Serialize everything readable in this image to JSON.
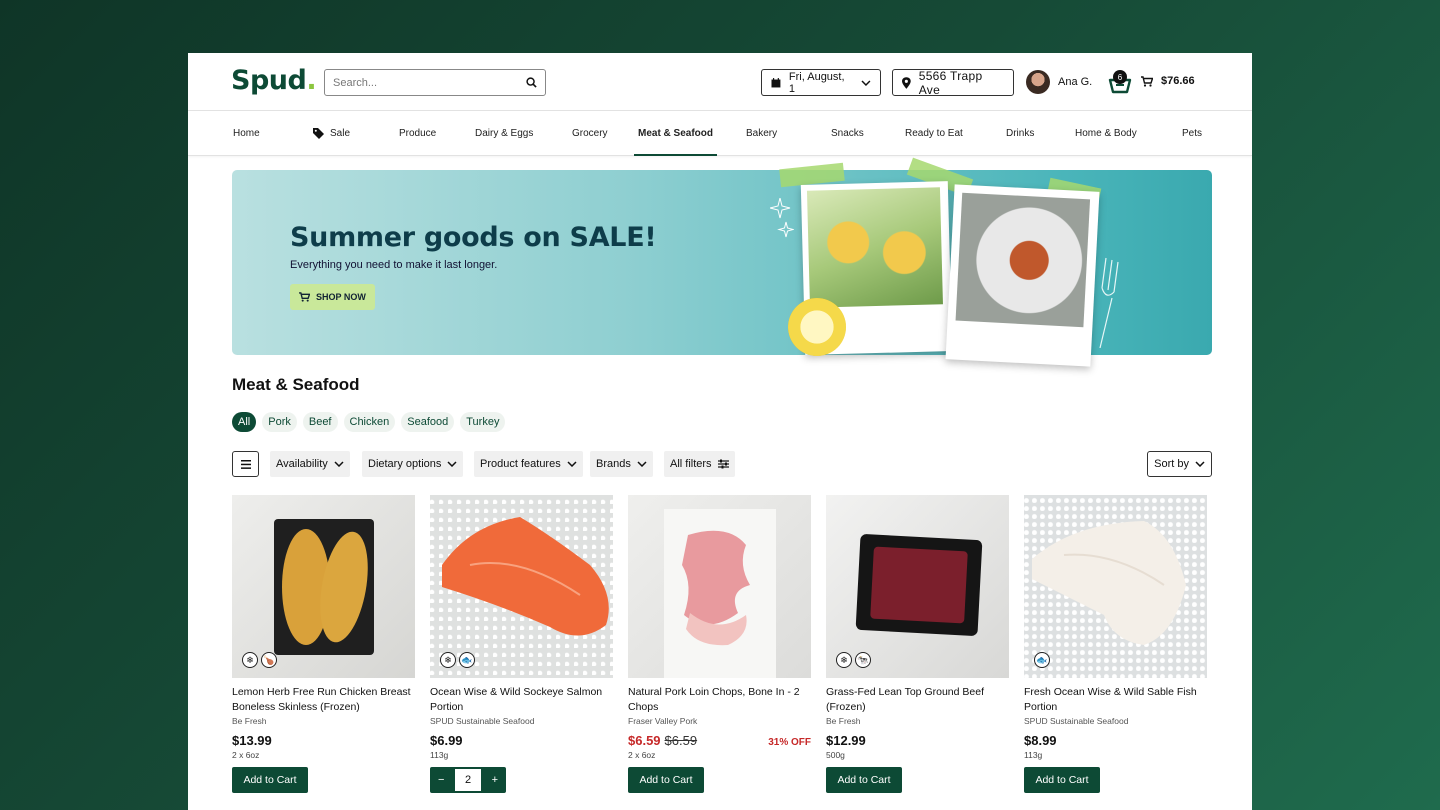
{
  "header": {
    "logo": "Spud",
    "logo_dot": ".",
    "search_placeholder": "Search...",
    "date": "Fri, August, 1",
    "address": "5566 Trapp Ave",
    "user_name": "Ana G.",
    "basket_count": "6",
    "cart_total": "$76.66"
  },
  "nav": {
    "items": [
      "Home",
      "Sale",
      "Produce",
      "Dairy & Eggs",
      "Grocery",
      "Meat & Seafood",
      "Bakery",
      "Snacks",
      "Ready to Eat",
      "Drinks",
      "Home & Body",
      "Pets"
    ],
    "active": "Meat & Seafood"
  },
  "banner": {
    "title": "Summer goods on SALE!",
    "subtitle": "Everything you need to make it last longer.",
    "button": "SHOP NOW"
  },
  "section": {
    "title": "Meat & Seafood",
    "chips": [
      "All",
      "Pork",
      "Beef",
      "Chicken",
      "Seafood",
      "Turkey"
    ],
    "active_chip": "All"
  },
  "filters": {
    "items": [
      "Availability",
      "Dietary options",
      "Product features",
      "Brands"
    ],
    "all_filters": "All filters",
    "sort": "Sort by"
  },
  "products": [
    {
      "name": "Lemon Herb Free Run Chicken Breast Boneless Skinless (Frozen)",
      "brand": "Be Fresh",
      "price": "$13.99",
      "size": "2 x 6oz",
      "button": "Add to Cart",
      "badges": [
        "snowflake-icon",
        "drumstick-icon"
      ]
    },
    {
      "name": "Ocean Wise & Wild Sockeye Salmon Portion",
      "brand": "SPUD Sustainable Seafood",
      "price": "$6.99",
      "size": "113g",
      "quantity": "2",
      "badges": [
        "snowflake-icon",
        "fish-icon"
      ]
    },
    {
      "name": "Natural Pork Loin Chops, Bone In - 2 Chops",
      "brand": "Fraser Valley Pork",
      "sale_price": "$6.59",
      "was_price": "$6.59",
      "discount": "31% OFF",
      "size": "2 x 6oz",
      "button": "Add to Cart",
      "badges": []
    },
    {
      "name": "Grass-Fed Lean Top Ground Beef (Frozen)",
      "brand": "Be Fresh",
      "price": "$12.99",
      "size": "500g",
      "button": "Add to Cart",
      "badges": [
        "snowflake-icon",
        "cow-icon"
      ]
    },
    {
      "name": "Fresh Ocean Wise & Wild Sable Fish Portion",
      "brand": "SPUD Sustainable Seafood",
      "price": "$8.99",
      "size": "113g",
      "button": "Add to Cart",
      "badges": [
        "fish-icon"
      ]
    }
  ],
  "colors": {
    "brand": "#0d4a35",
    "accent": "#8cc63f",
    "sale": "#c62828",
    "banner": "#4ab5ba"
  }
}
